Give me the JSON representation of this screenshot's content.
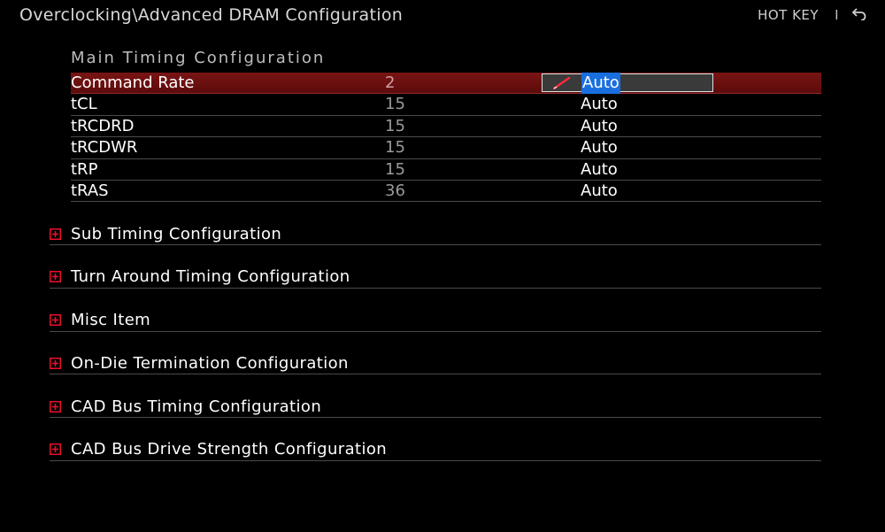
{
  "header": {
    "breadcrumb": "Overclocking\\Advanced DRAM Configuration",
    "hotkey_label": "HOT KEY",
    "separator": "I",
    "back_icon": "back-arrow-icon"
  },
  "main_timing": {
    "title": "Main Timing Configuration",
    "rows": [
      {
        "label": "Command Rate",
        "current": "2",
        "setting": "Auto",
        "selected": true
      },
      {
        "label": "tCL",
        "current": "15",
        "setting": "Auto"
      },
      {
        "label": "tRCDRD",
        "current": "15",
        "setting": "Auto"
      },
      {
        "label": "tRCDWR",
        "current": "15",
        "setting": "Auto"
      },
      {
        "label": "tRP",
        "current": "15",
        "setting": "Auto"
      },
      {
        "label": "tRAS",
        "current": "36",
        "setting": "Auto"
      }
    ]
  },
  "groups": [
    {
      "label": "Sub Timing Configuration"
    },
    {
      "label": "Turn Around Timing Configuration"
    },
    {
      "label": "Misc Item"
    },
    {
      "label": "On-Die Termination Configuration"
    },
    {
      "label": "CAD Bus Timing Configuration"
    },
    {
      "label": "CAD Bus Drive Strength Configuration"
    }
  ],
  "colors": {
    "background": "#000000",
    "selected_row": "#6b1010",
    "highlight": "#1a6fe0",
    "expand_icon": "#e8102a"
  }
}
